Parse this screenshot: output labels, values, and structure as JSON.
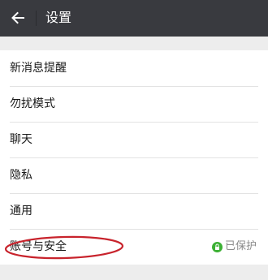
{
  "header": {
    "title": "设置",
    "back_icon": "arrow-left-icon"
  },
  "settings": {
    "items": [
      {
        "label": "新消息提醒"
      },
      {
        "label": "勿扰模式"
      },
      {
        "label": "聊天"
      },
      {
        "label": "隐私"
      },
      {
        "label": "通用"
      },
      {
        "label": "账号与安全",
        "status": "已保护",
        "status_icon": "lock-icon"
      }
    ]
  },
  "colors": {
    "header_bg": "#393a3f",
    "page_bg": "#ededed",
    "protect_green": "#3cb034",
    "highlight_red": "#c8232c"
  }
}
